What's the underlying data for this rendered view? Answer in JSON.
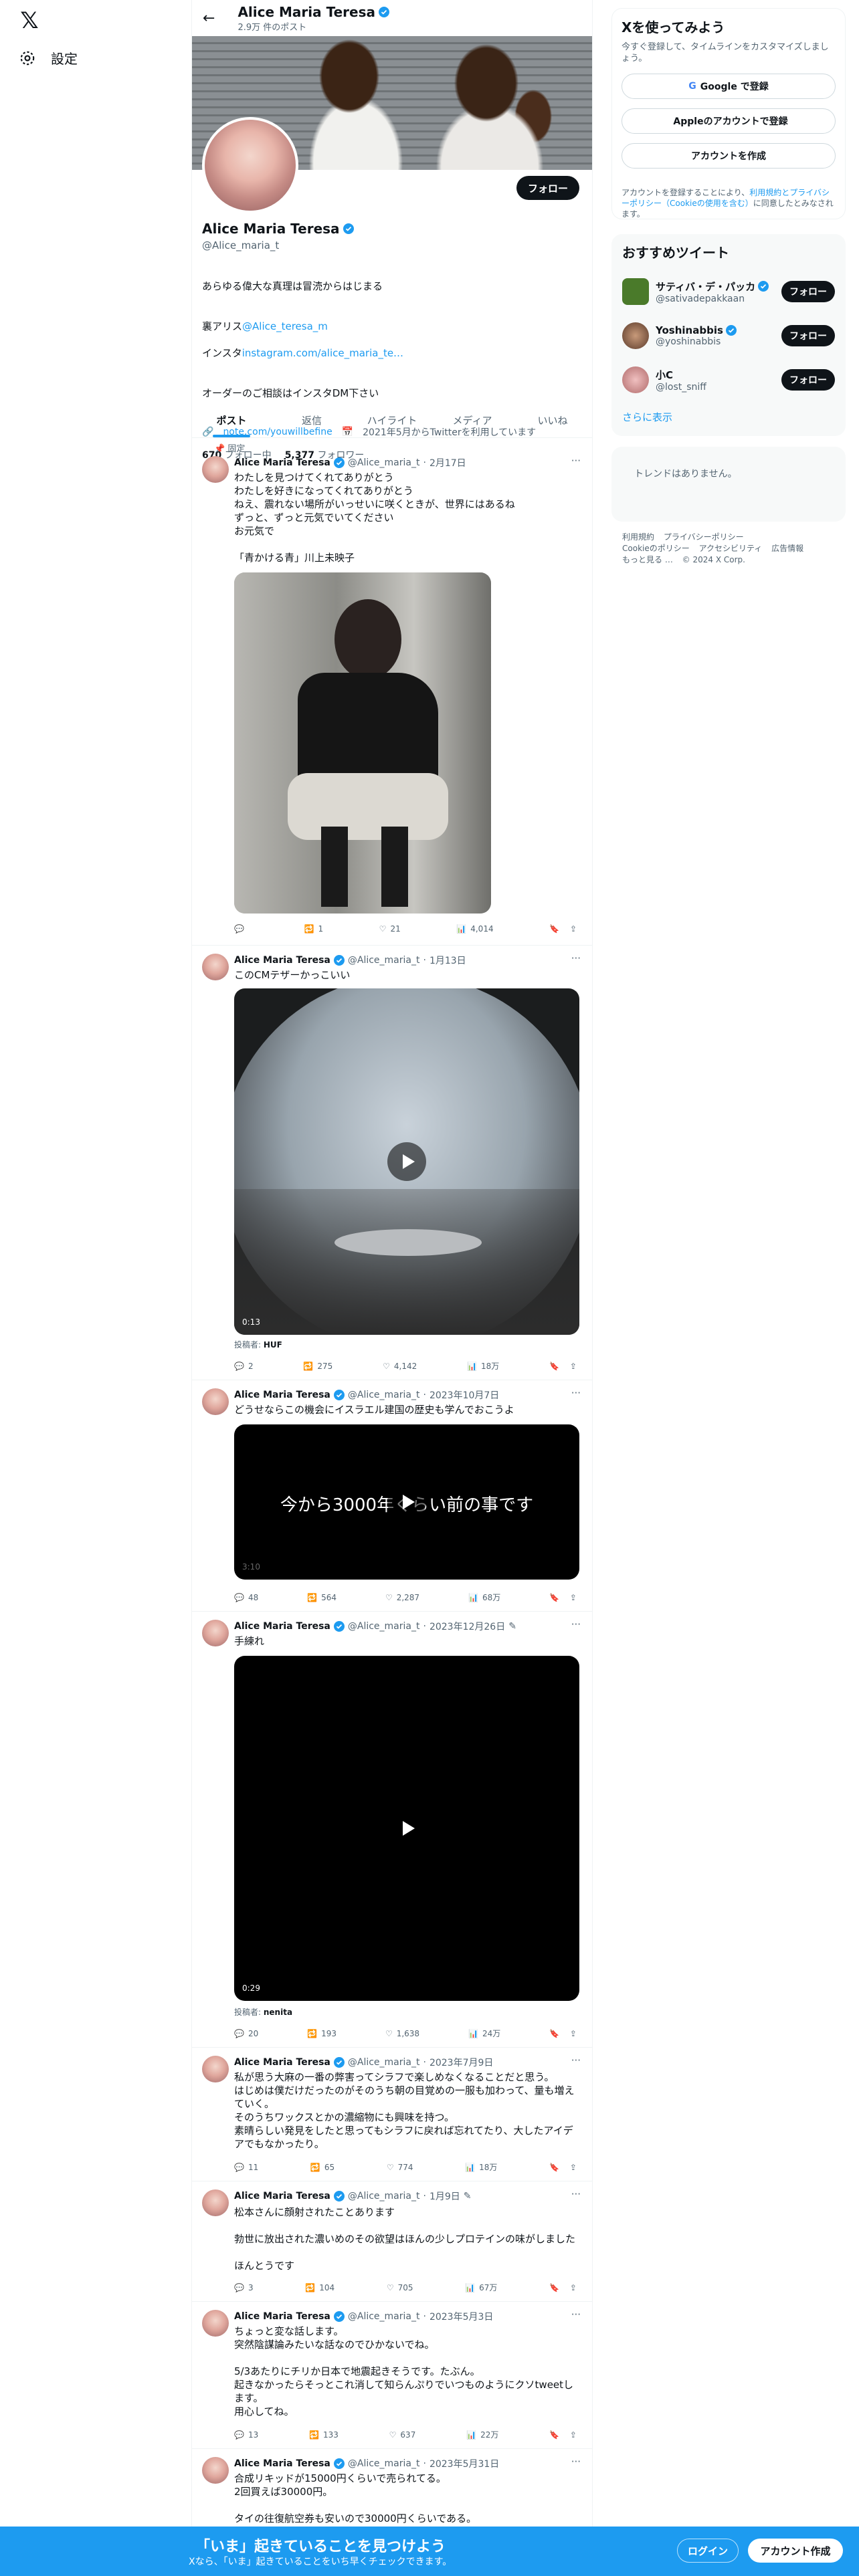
{
  "nav": {
    "settings_label": "設定"
  },
  "header": {
    "name": "Alice Maria Teresa",
    "post_count": "2.9万 件のポスト"
  },
  "profile": {
    "name": "Alice Maria Teresa",
    "handle": "@Alice_maria_t",
    "bio_line1": "あらゆる偉大な真理は冒涜からはじまる",
    "bio_prefix1": "裏アリス",
    "bio_link1": "@Alice_teresa_m",
    "bio_prefix2": "インスタ",
    "bio_link2": "instagram.com/alice_maria_te…",
    "bio_line4": "オーダーのご相談はインスタDM下さい",
    "website": "note.com/youwillbefine",
    "joined": "2021年5月からTwitterを利用しています",
    "following": "670",
    "following_label": "フォロー中",
    "followers": "5,377",
    "followers_label": "フォロワー",
    "follow_label": "フォロー"
  },
  "tabs": [
    "ポスト",
    "返信",
    "ハイライト",
    "メディア",
    "いいね"
  ],
  "pinned_label": "固定",
  "verified_color": "#1d9bf0",
  "tweets": [
    {
      "name": "Alice Maria Teresa",
      "handle": "@Alice_maria_t",
      "date": "2月17日",
      "text": "わたしを見つけてくれてありがとう\nわたしを好きになってくれてありがとう\nねえ、震れない場所がいっせいに咲くときが、世界にはあるね\nずっと、ずっと元気でいてください\nお元気で\n\n「青かける青」川上未映子",
      "replies": "",
      "retweets": "1",
      "likes": "21",
      "views": "4,014"
    },
    {
      "name": "Alice Maria Teresa",
      "handle": "@Alice_maria_t",
      "date": "1月13日",
      "text": "このCMテザーかっこいい",
      "duration": "0:13",
      "from_label": "投稿者:",
      "from_user": "HUF",
      "replies": "2",
      "retweets": "275",
      "likes": "4,142",
      "views": "18万"
    },
    {
      "name": "Alice Maria Teresa",
      "handle": "@Alice_maria_t",
      "date": "2023年10月7日",
      "text": "どうせならこの機会にイスラエル建国の歴史も学んでおこうよ",
      "video_caption": "今から3000年くらい前の事です",
      "duration": "3:10",
      "replies": "48",
      "retweets": "564",
      "likes": "2,287",
      "views": "68万"
    },
    {
      "name": "Alice Maria Teresa",
      "handle": "@Alice_maria_t",
      "date": "2023年12月26日",
      "text": "手練れ",
      "duration": "0:29",
      "from_label": "投稿者:",
      "from_user": "nenita",
      "replies": "20",
      "retweets": "193",
      "likes": "1,638",
      "views": "24万"
    },
    {
      "name": "Alice Maria Teresa",
      "handle": "@Alice_maria_t",
      "date": "2023年7月9日",
      "text": "私が思う大麻の一番の弊害ってシラフで楽しめなくなることだと思う。\nはじめは僕だけだったのがそのうち朝の目覚めの一服も加わって、量も増えていく。\nそのうちワックスとかの濃縮物にも興味を持つ。\n素晴らしい発見をしたと思ってもシラフに戻れば忘れてたり、大したアイデアでもなかったり。",
      "replies": "11",
      "retweets": "65",
      "likes": "774",
      "views": "18万"
    },
    {
      "name": "Alice Maria Teresa",
      "handle": "@Alice_maria_t",
      "date": "1月9日",
      "text": "松本さんに顔射されたことあります\n\n勃世に放出された濃いめのその欲望はほんの少しプロテインの味がしました\n\nほんとうです",
      "replies": "3",
      "retweets": "104",
      "likes": "705",
      "views": "67万"
    },
    {
      "name": "Alice Maria Teresa",
      "handle": "@Alice_maria_t",
      "date": "2023年5月3日",
      "text": "ちょっと変な話します。\n突然陰謀論みたいな話なのでひかないでね。\n\n5/3あたりにチリか日本で地震起きそうです。たぶん。\n起きなかったらそっとこれ消して知らんぷりでいつものようにクソtweetします。\n用心してね。",
      "replies": "13",
      "retweets": "133",
      "likes": "637",
      "views": "22万"
    },
    {
      "name": "Alice Maria Teresa",
      "handle": "@Alice_maria_t",
      "date": "2023年5月31日",
      "text": "合成リキッドが15000円くらいで売られてる。\n2回買えば30000円。\n\nタイの往復航空券も安いので30000円くらいである。"
    }
  ],
  "signup": {
    "title": "Xを使ってみよう",
    "subtitle": "今すぐ登録して、タイムラインをカスタマイズしましょう。",
    "google": "Google で登録",
    "apple": "Appleのアカウントで登録",
    "create": "アカウントを作成",
    "legal_prefix": "アカウントを登録することにより、",
    "legal_link": "利用規約とプライバシーポリシー（Cookieの使用を含む）",
    "legal_suffix": "に同意したとみなされます。"
  },
  "recommend": {
    "title": "おすすめツイート",
    "users": [
      {
        "name": "サティバ・デ・パッカ",
        "handle": "@sativadepakkaan"
      },
      {
        "name": "Yoshinabbis",
        "handle": "@yoshinabbis"
      },
      {
        "name": "小C",
        "handle": "@lost_sniff"
      }
    ],
    "follow_label": "フォロー",
    "show_more": "さらに表示"
  },
  "trends": {
    "empty": "トレンドはありません。"
  },
  "footer": {
    "links": [
      "利用規約",
      "プライバシーポリシー",
      "Cookieのポリシー",
      "アクセシビリティ",
      "広告情報",
      "もっと見る …",
      "© 2024 X Corp."
    ]
  },
  "bottom_bar": {
    "title": "「いま」起きていることを見つけよう",
    "subtitle": "Xなら、「いま」起きていることをいち早くチェックできます。",
    "login": "ログイン",
    "signup": "アカウント作成"
  }
}
